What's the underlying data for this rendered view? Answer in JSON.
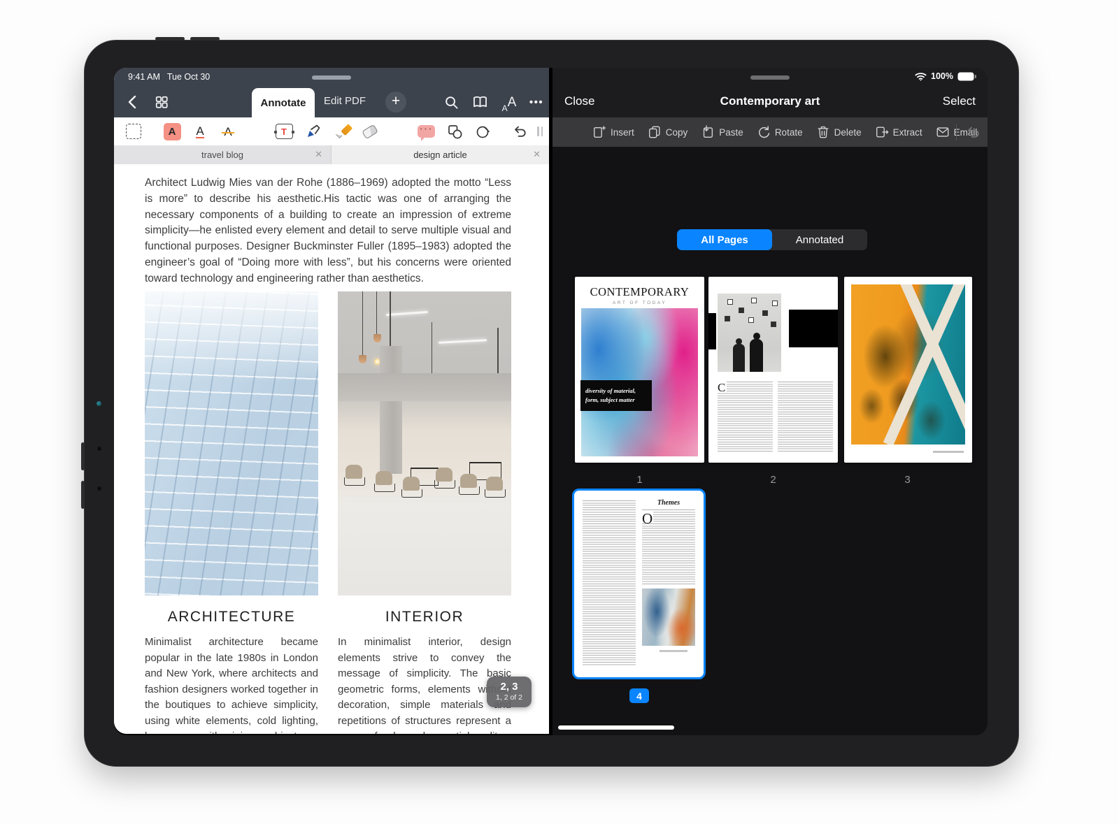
{
  "status": {
    "time": "9:41 AM",
    "date": "Tue Oct 30",
    "battery": "100%"
  },
  "colors": {
    "accent_blue": "#0a84ff",
    "chrome_slate": "#3c434d",
    "highlight_salmon": "#f49084",
    "dark_panel": "#1c1c1e"
  },
  "left": {
    "nav": {
      "annotate_tab": "Annotate",
      "edit_pdf_tab": "Edit PDF"
    },
    "doc_tabs": {
      "first": "travel blog",
      "second": "design article",
      "close_glyph": "✕"
    },
    "article": {
      "intro": "Architect Ludwig Mies van der Rohe (1886–1969) adopted the motto “Less is more” to describe his aesthetic.His tactic was one of arranging the necessary components of a building to create an impression of extreme simplicity—he enlisted every element and detail to serve multiple visual and functional purposes. Designer Buckminster Fuller (1895–1983) adopted the engineer’s goal of “Doing more with less”, but his concerns were oriented toward technology and engineering rather than aesthetics.",
      "col1_title": "ARCHITECTURE",
      "col1_text": "Minimalist architecture became popular in the late 1980s in London and New York, where architects and fashion designers worked together in the boutiques to achieve simplicity, using white elements, cold lighting, large space with minimum objects.",
      "col2_title": "INTERIOR",
      "col2_text": "In minimalist interior, design elements strive to convey the message of simplicity. The basic geometric forms, elements without decoration, simple materials and repetitions of structures represent a sense of order and essential quality."
    },
    "page_badge": {
      "primary": "2, 3",
      "secondary": "1, 2 of 2"
    }
  },
  "right": {
    "nav": {
      "close": "Close",
      "title": "Contemporary art",
      "select": "Select"
    },
    "toolbar": {
      "insert": "Insert",
      "copy": "Copy",
      "paste": "Paste",
      "rotate": "Rotate",
      "delete": "Delete",
      "extract": "Extract",
      "email": "Email"
    },
    "segments": {
      "all_pages": "All Pages",
      "annotated": "Annotated"
    },
    "pages": {
      "p1": "1",
      "p2": "2",
      "p3": "3",
      "p4": "4"
    },
    "thumb1": {
      "title": "CONTEMPORARY",
      "subtitle": "ART OF TODAY",
      "tag": "diversity of material, form, subject matter"
    },
    "thumb2": {
      "dropcap": "C"
    },
    "thumb4": {
      "heading": "Themes",
      "dropcap": "O"
    }
  },
  "icons": {
    "back": "chevron-left",
    "grid": "thumbnails-grid",
    "add": "plus-circle",
    "search": "magnifier",
    "reader": "open-book",
    "text_size": "AA",
    "more": "ellipsis",
    "select_marquee": "dashed-rect",
    "text_highlight": "A-highlight",
    "text_underline": "A-underline",
    "text_strikeout": "A-strikeout",
    "text_box": "T-box",
    "pen": "pen",
    "highlighter": "marker",
    "eraser": "eraser",
    "comment": "speech-bubble",
    "shapes": "square-circle",
    "lasso": "lasso-circle",
    "undo": "undo-arrow",
    "wifi": "wifi",
    "battery": "battery-full",
    "insert": "page-plus",
    "copy": "pages",
    "paste": "page-arrow-in",
    "rotate": "circular-arrow",
    "delete": "trash",
    "extract": "page-arrow-out",
    "email": "envelope"
  }
}
